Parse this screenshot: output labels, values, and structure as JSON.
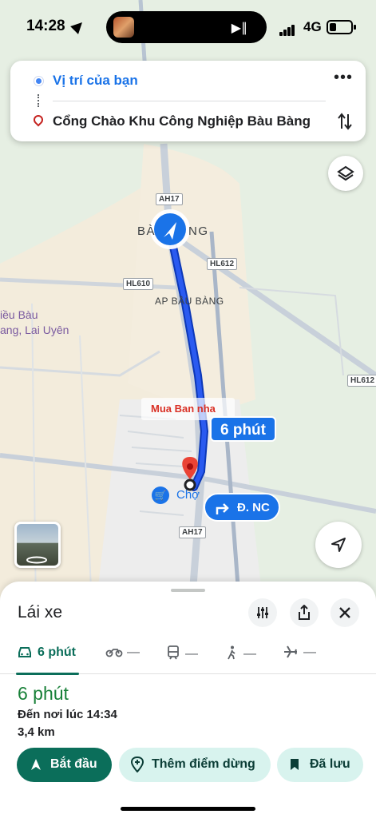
{
  "status_bar": {
    "time": "14:28",
    "network": "4G"
  },
  "route_card": {
    "origin": "Vị trí của bạn",
    "destination": "Cổng Chào Khu Công Nghiệp Bàu Bàng"
  },
  "map": {
    "area_label_1": "BÀ",
    "area_label_1b": "NG",
    "area_label_2": "AP BẦU BÀNG",
    "place_label_1": "iều Bàu",
    "place_label_2": "ang, Lai Uyên",
    "roads": {
      "ah17_top": "AH17",
      "ah17_bottom": "AH17",
      "hl612_a": "HL612",
      "hl612_b": "HL612",
      "hl610": "HL610"
    },
    "route_time": "6 phút",
    "turn_label": "Đ. NC",
    "shop_label": "Chợ",
    "watermark": "Mua Ban nha",
    "colors": {
      "route": "#1a57e8",
      "accent": "#0b6e5a"
    }
  },
  "sheet": {
    "title": "Lái xe",
    "modes": [
      {
        "label": "6 phút",
        "icon": "car-icon"
      },
      {
        "label": "—",
        "icon": "motorbike-icon"
      },
      {
        "label": "—",
        "icon": "transit-icon"
      },
      {
        "label": "—",
        "icon": "walk-icon"
      },
      {
        "label": "—",
        "icon": "flight-icon"
      }
    ],
    "duration": "6 phút",
    "arrival": "Đến nơi lúc 14:34",
    "distance": "3,4 km",
    "buttons": {
      "start": "Bắt đầu",
      "add_stop": "Thêm điểm dừng",
      "saved": "Đã lưu"
    }
  }
}
